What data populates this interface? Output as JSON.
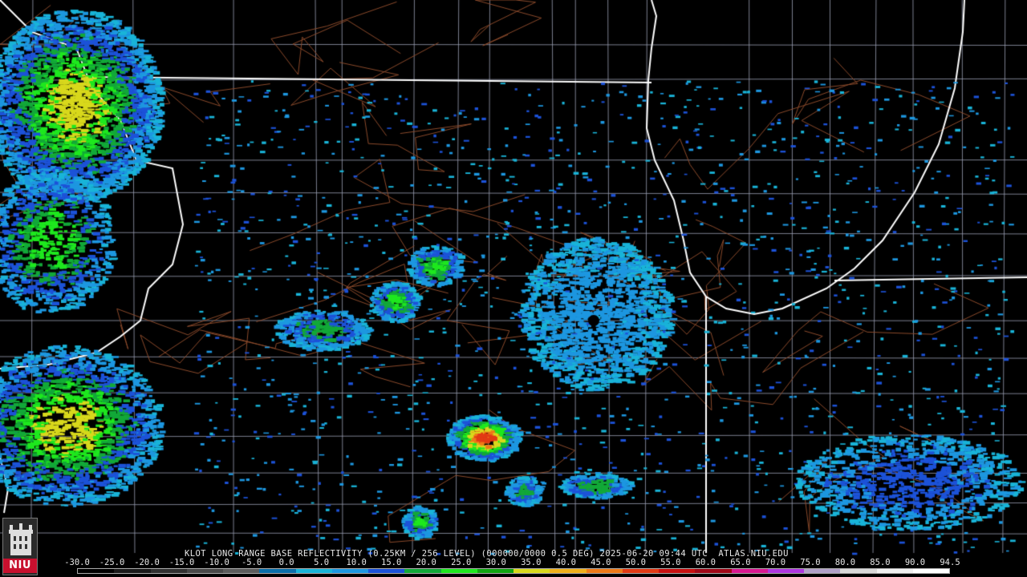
{
  "map": {
    "radar_site": "KLOT",
    "product": "LONG RANGE BASE REFLECTIVITY",
    "info_line": "KLOT LONG RANGE BASE REFLECTIVITY (0.25KM / 256 LEVEL) (000000/0000 0.5 DEG) 2025-06-20 09:44 UTC  ATLAS.NIU.EDU",
    "background_color": "#000000",
    "state_border_color": "#ffffff",
    "county_border_color": "#9aa0b4",
    "road_color": "#8b4a2b"
  },
  "legend": {
    "unit_scale_labels": [
      "-30.0",
      "-25.0",
      "-20.0",
      "-15.0",
      "-10.0",
      "-5.0",
      "0.0",
      "5.0",
      "10.0",
      "15.0",
      "20.0",
      "25.0",
      "30.0",
      "35.0",
      "40.0",
      "45.0",
      "50.0",
      "55.0",
      "60.0",
      "65.0",
      "70.0",
      "75.0",
      "80.0",
      "85.0",
      "90.0",
      "94.5"
    ],
    "colors": [
      "#000000",
      "#1a1a1a",
      "#303030",
      "#484848",
      "#5c5c5c",
      "#0a6ea8",
      "#19b4d8",
      "#1d97e0",
      "#1c52d8",
      "#12a838",
      "#1ee81e",
      "#11a511",
      "#d8d81c",
      "#f0b01a",
      "#ee7a18",
      "#e23a14",
      "#c81010",
      "#a00818",
      "#d81890",
      "#ae36e0",
      "#b0a0c8",
      "#d8d8d8",
      "#f0f0f0",
      "#ffffff"
    ]
  },
  "logo": {
    "text": "NIU",
    "color": "#c8102e"
  }
}
